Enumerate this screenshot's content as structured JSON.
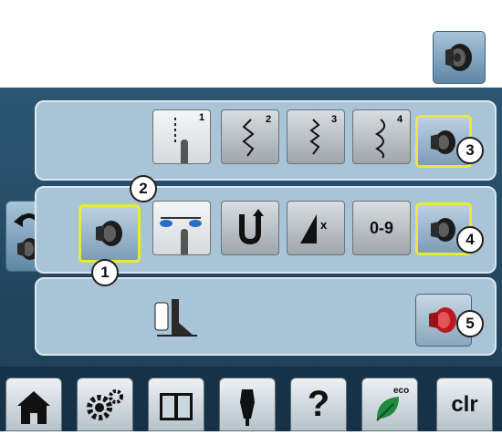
{
  "callouts": [
    "1",
    "2",
    "3",
    "4",
    "5"
  ],
  "row_mid": {
    "digits_label": "0-9",
    "alpha_glyph": "x"
  },
  "stitch_superscripts": [
    "1",
    "2",
    "3",
    "4"
  ],
  "nav": {
    "clr_label": "clr",
    "help_label": "?",
    "eco_label": "eco"
  },
  "icons": {
    "speaker": "speaker-icon",
    "back": "back-arrow-icon",
    "home": "home-icon",
    "settings": "gear-icon",
    "tutorial": "book-icon",
    "creative": "dress-form-icon",
    "help": "help-icon",
    "eco": "eco-leaf-icon"
  },
  "colors": {
    "selection": "#e7ea3b",
    "panel": "#a9c3d7",
    "screen": "#254a66",
    "muted_speaker": "#d9262b"
  }
}
